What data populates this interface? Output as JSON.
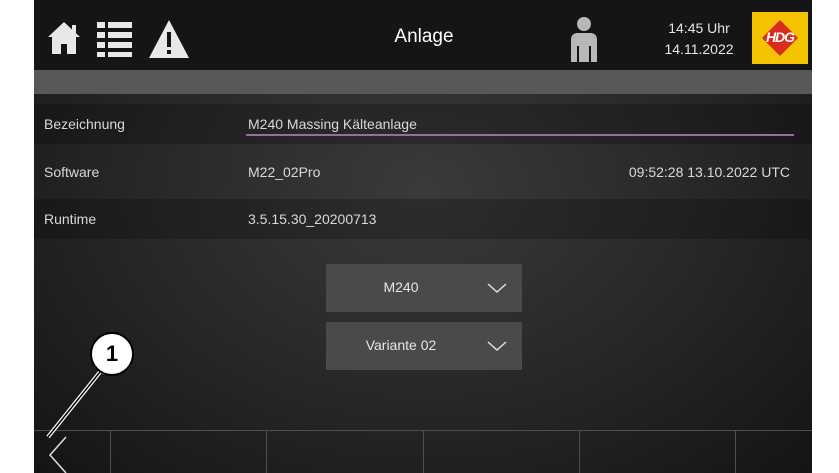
{
  "header": {
    "title": "Anlage",
    "time": "14:45 Uhr",
    "date": "14.11.2022",
    "logo_text": "HDG",
    "icons": [
      "home-icon",
      "list-icon",
      "warning-icon",
      "user-icon"
    ]
  },
  "info_rows": [
    {
      "label": "Bezeichnung",
      "value": "M240 Massing Kälteanlage",
      "extra": ""
    },
    {
      "label": "Software",
      "value": "M22_02Pro",
      "extra": "09:52:28 13.10.2022 UTC"
    },
    {
      "label": "Runtime",
      "value": "3.5.15.30_20200713",
      "extra": ""
    }
  ],
  "dropdowns": [
    {
      "selected": "M240"
    },
    {
      "selected": "Variante 02"
    }
  ],
  "bottom_nav": {
    "back_icon": "chevron-left-icon"
  },
  "callout": {
    "number": "1"
  },
  "colors": {
    "accent_underline": "#9b6aa0",
    "logo_bg": "#f5c400",
    "logo_red": "#d92b1e"
  }
}
